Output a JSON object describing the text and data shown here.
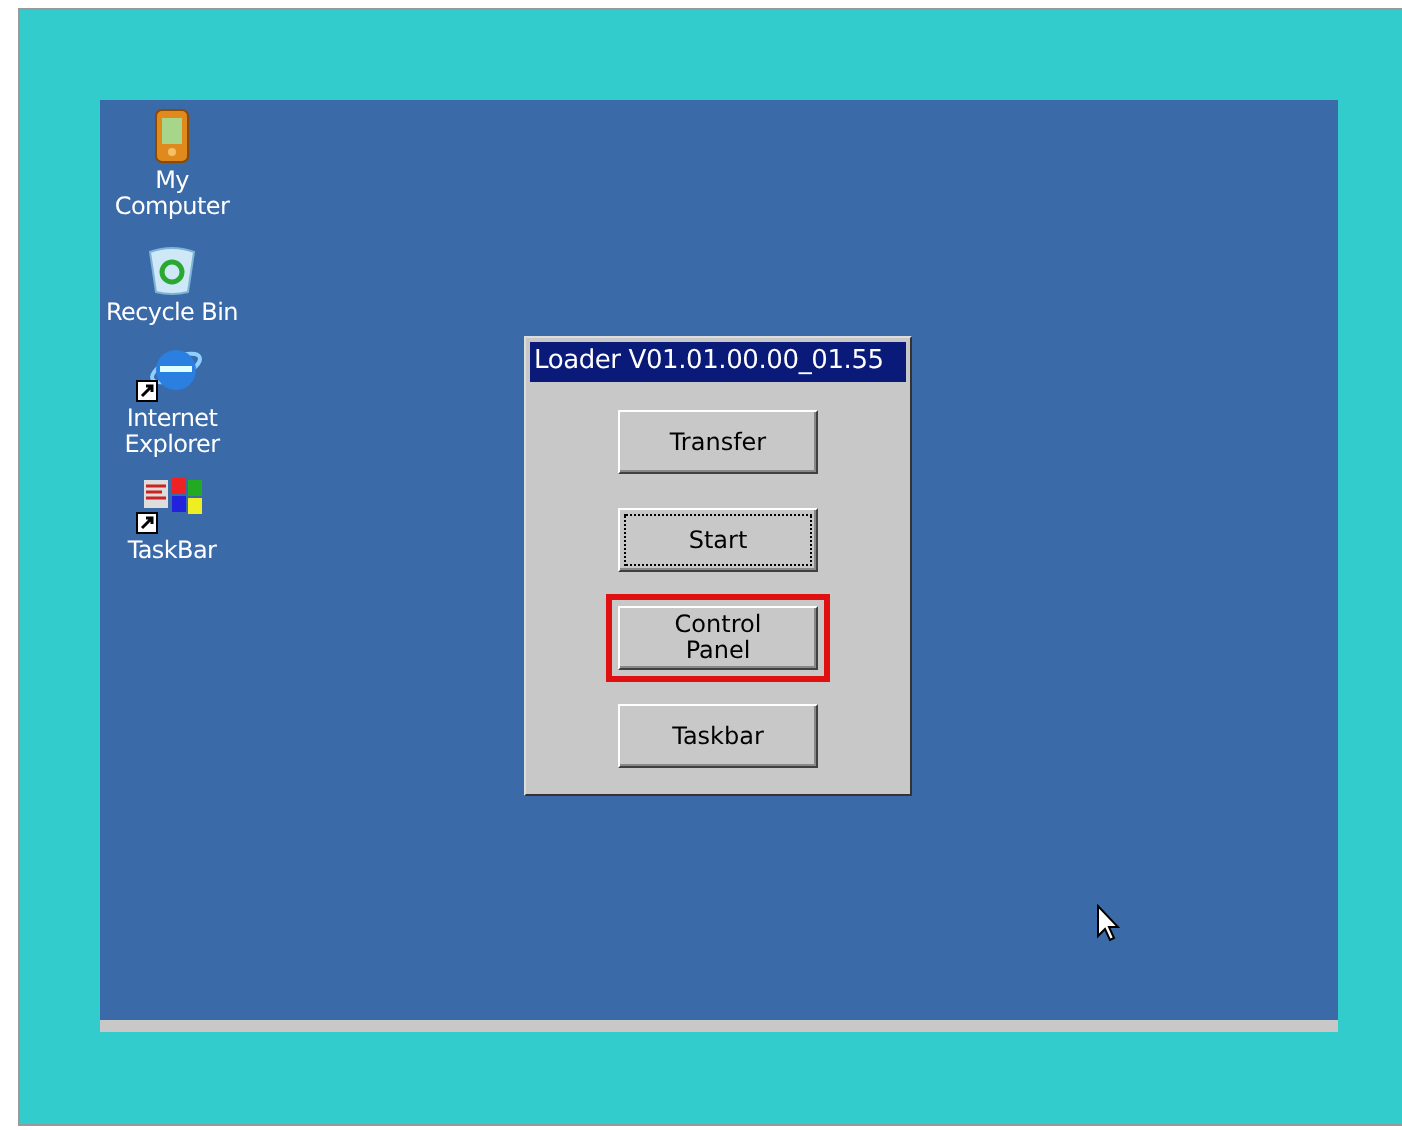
{
  "desktop": {
    "icons": [
      {
        "kind": "computer",
        "label": "My Computer"
      },
      {
        "kind": "recycle",
        "label": "Recycle Bin"
      },
      {
        "kind": "browser",
        "label": "Internet Explorer",
        "shortcut": true
      },
      {
        "kind": "taskbar",
        "label": "TaskBar",
        "shortcut": true
      }
    ]
  },
  "dialog": {
    "title": "Loader V01.01.00.00_01.55",
    "buttons": [
      {
        "label": "Transfer",
        "focused": false,
        "highlighted": false
      },
      {
        "label": "Start",
        "focused": true,
        "highlighted": false
      },
      {
        "label": "Control\nPanel",
        "focused": false,
        "highlighted": true
      },
      {
        "label": "Taskbar",
        "focused": false,
        "highlighted": false
      }
    ]
  }
}
